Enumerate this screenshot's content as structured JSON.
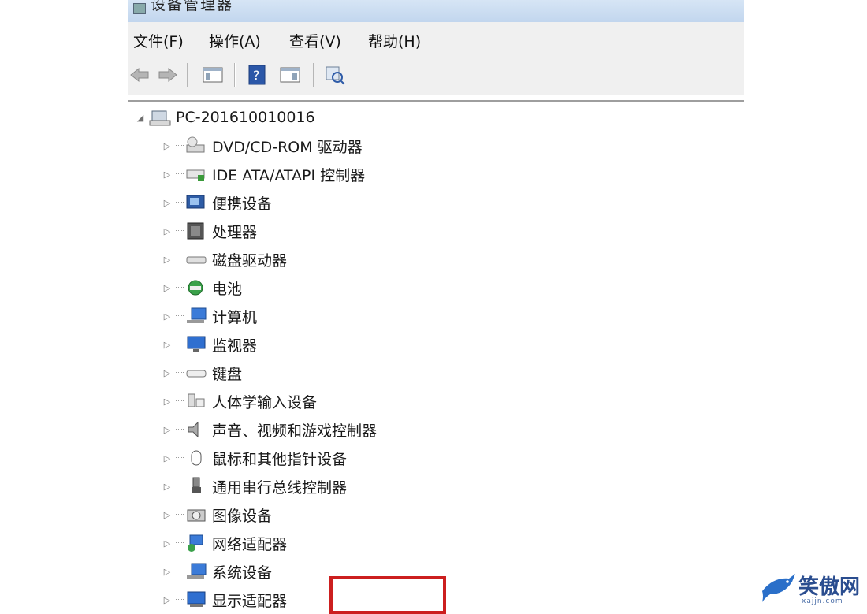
{
  "window": {
    "title": "设备管理器"
  },
  "menu": [
    "文件(F)",
    "操作(A)",
    "查看(V)",
    "帮助(H)"
  ],
  "toolbar": [
    "back-icon",
    "forward-icon",
    "show-hide-tree-icon",
    "help-icon",
    "properties-icon",
    "scan-hardware-icon"
  ],
  "tree": {
    "root": "PC-201610010016",
    "children": [
      "DVD/CD-ROM 驱动器",
      "IDE ATA/ATAPI 控制器",
      "便携设备",
      "处理器",
      "磁盘驱动器",
      "电池",
      "计算机",
      "监视器",
      "键盘",
      "人体学输入设备",
      "声音、视频和游戏控制器",
      "鼠标和其他指针设备",
      "通用串行总线控制器",
      "图像设备",
      "网络适配器",
      "系统设备",
      "显示适配器"
    ]
  },
  "highlight_color": "#cc1f1f",
  "watermark": {
    "text": "笑傲网",
    "sub": "xajjn.com"
  }
}
